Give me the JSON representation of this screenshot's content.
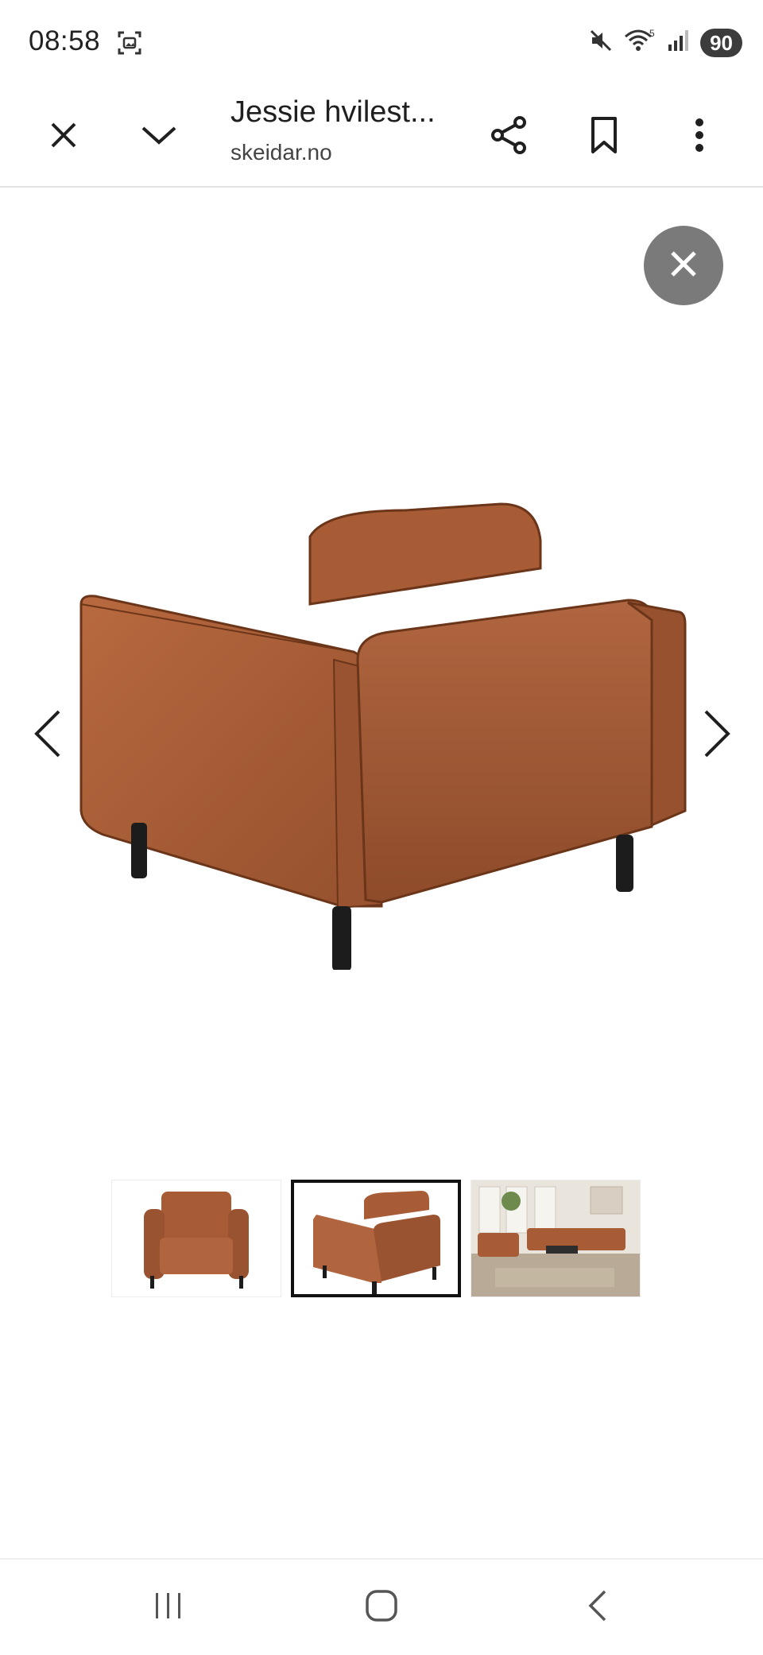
{
  "status": {
    "time": "08:58",
    "battery": "90",
    "wifi_badge": "5"
  },
  "toolbar": {
    "title": "Jessie hvilest...",
    "domain": "skeidar.no"
  },
  "icons": {
    "screenshot": "screenshot-icon",
    "mute": "mute-icon",
    "wifi": "wifi-icon",
    "signal": "signal-icon",
    "close": "close-icon",
    "collapse": "chevron-down-icon",
    "share": "share-icon",
    "bookmark": "bookmark-icon",
    "more": "more-vert-icon",
    "prev": "chevron-left-icon",
    "next": "chevron-right-icon"
  },
  "viewer": {
    "thumbnail_count": 3,
    "selected_index": 2
  },
  "colors": {
    "leather": "#a55a35",
    "leg": "#1c1c1c",
    "fab": "#7a7a7a"
  }
}
